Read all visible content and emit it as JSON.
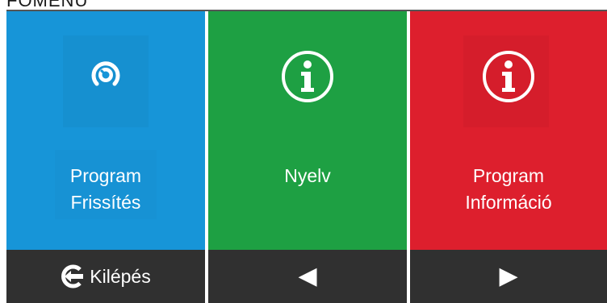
{
  "header": {
    "title": "FŐMENÜ"
  },
  "panels": [
    {
      "line1": "Program",
      "line2": "Frissítés",
      "icon": "update-icon",
      "color": "#1795d8"
    },
    {
      "line1": "Nyelv",
      "line2": "",
      "icon": "info-icon",
      "color": "#1ea043"
    },
    {
      "line1": "Program",
      "line2": "Információ",
      "icon": "info-icon",
      "color": "#dd1f2d"
    }
  ],
  "footer": {
    "exit_label": "Kilépés",
    "exit_icon": "exit-arrow-icon",
    "prev_glyph": "◀",
    "next_glyph": "▶"
  }
}
